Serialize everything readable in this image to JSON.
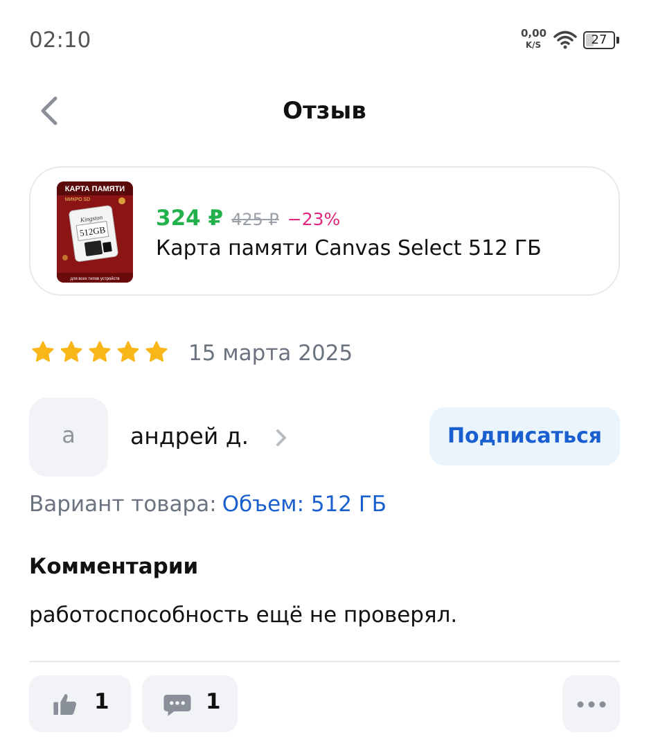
{
  "status_bar": {
    "time": "02:10",
    "net_speed_value": "0,00",
    "net_speed_unit": "K/S",
    "battery_level": "27"
  },
  "header": {
    "title": "Отзыв"
  },
  "product": {
    "price_current": "324 ₽",
    "price_old": "425 ₽",
    "discount": "−23%",
    "name": "Карта памяти Canvas Select 512 ГБ",
    "image": {
      "banner_text": "КАРТА ПАМЯТИ",
      "sub_text": "МИКРО SD",
      "brand": "Kingston",
      "capacity": "512GB",
      "footer_text": "для всех типов устройств"
    }
  },
  "review": {
    "rating": 5,
    "rating_max": 5,
    "date": "15 марта 2025"
  },
  "author": {
    "avatar_letter": "а",
    "name": "андрей д.",
    "subscribe_label": "Подписаться"
  },
  "variant": {
    "label": "Вариант товара:",
    "value": "Объем: 512 ГБ"
  },
  "comments": {
    "heading": "Комментарии",
    "text": "работоспособность ещё не проверял."
  },
  "actions": {
    "likes_count": "1",
    "comments_count": "1"
  },
  "colors": {
    "price_green": "#22b14c",
    "discount_pink": "#e0257d",
    "link_blue": "#1a5fcf",
    "star_yellow": "#f9b618",
    "muted_gray": "#6b7280"
  },
  "icons": {
    "back": "chevron-left-icon",
    "author_chevron": "chevron-right-icon",
    "star": "star-icon",
    "like": "thumbs-up-icon",
    "comment": "chat-bubble-icon",
    "more": "more-dots-icon",
    "wifi": "wifi-icon",
    "battery": "battery-icon"
  }
}
